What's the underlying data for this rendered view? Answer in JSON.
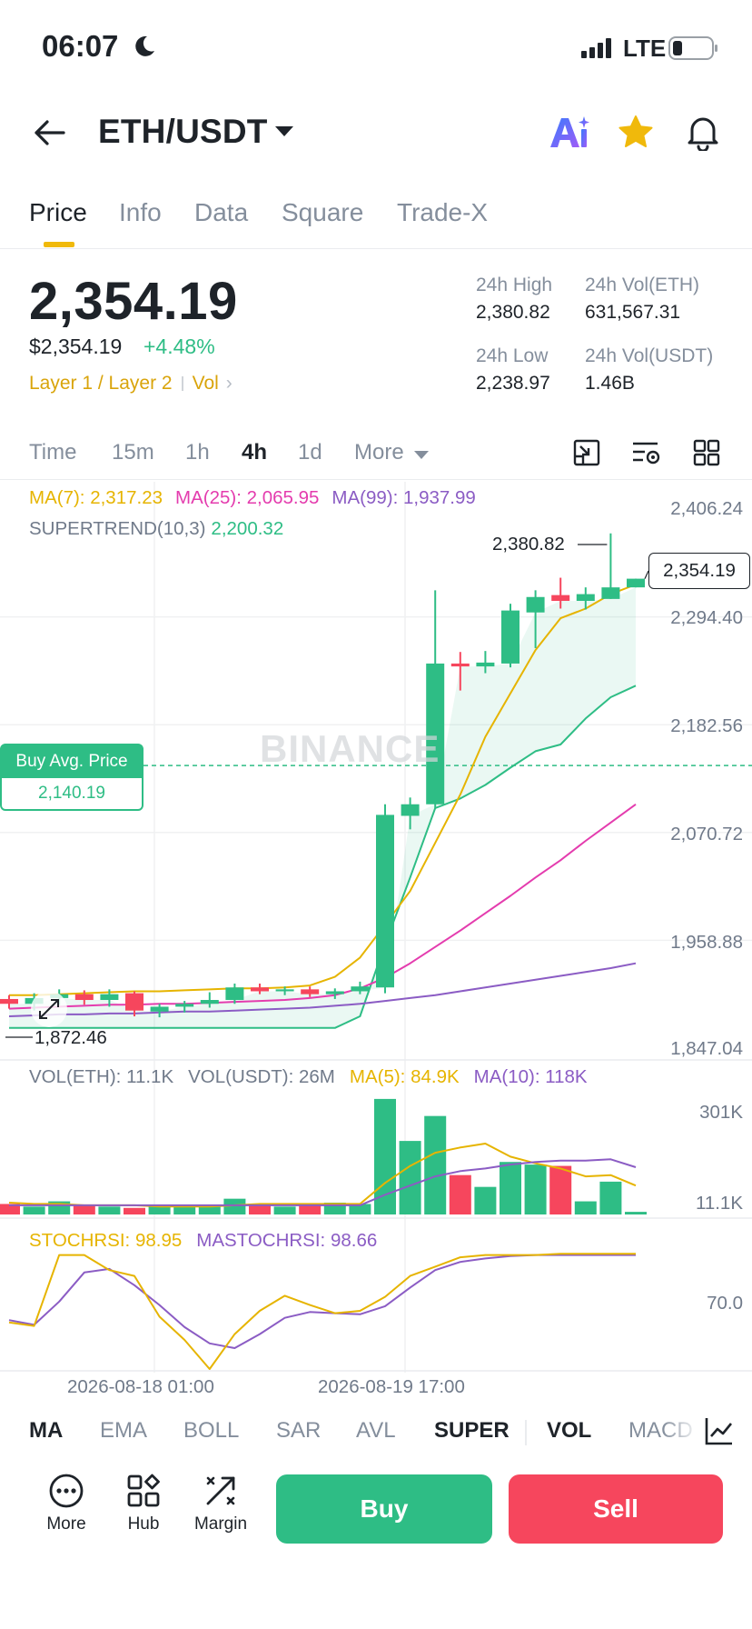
{
  "status": {
    "time": "06:07",
    "network": "LTE"
  },
  "header": {
    "pair": "ETH/USDT",
    "icons": [
      "back-arrow-icon",
      "ai-icon",
      "star-icon",
      "bell-icon"
    ]
  },
  "tabs": [
    {
      "label": "Price",
      "active": true
    },
    {
      "label": "Info"
    },
    {
      "label": "Data"
    },
    {
      "label": "Square"
    },
    {
      "label": "Trade-X"
    }
  ],
  "ticker": {
    "price": "2,354.19",
    "usd_price": "$2,354.19",
    "change": "+4.48%",
    "tag1": "Layer 1 / Layer 2",
    "tag2": "Vol",
    "stats": {
      "high_label": "24h High",
      "high": "2,380.82",
      "vol_eth_label": "24h Vol(ETH)",
      "vol_eth": "631,567.31",
      "low_label": "24h Low",
      "low": "2,238.97",
      "vol_usdt_label": "24h Vol(USDT)",
      "vol_usdt": "1.46B"
    }
  },
  "timeframes": {
    "items": [
      "Time",
      "15m",
      "1h",
      "4h",
      "1d",
      "More"
    ],
    "active": "4h"
  },
  "legend": {
    "ma7": "MA(7): 2,317.23",
    "ma25": "MA(25): 2,065.95",
    "ma99": "MA(99): 1,937.99",
    "supertrend_label": "SUPERTREND(10,3)",
    "supertrend_value": "2,200.32"
  },
  "price_axis": [
    "2,406.24",
    "2,294.40",
    "2,182.56",
    "2,070.72",
    "1,958.88",
    "1,847.04"
  ],
  "markers": {
    "current_price": "2,354.19",
    "high": "2,380.82",
    "low": "1,872.46",
    "buy_avg_label": "Buy Avg. Price",
    "buy_avg_value": "2,140.19",
    "watermark": "BINANCE"
  },
  "volume": {
    "vol_eth": "VOL(ETH): 11.1K",
    "vol_usdt": "VOL(USDT): 26M",
    "ma5": "MA(5): 84.9K",
    "ma10": "MA(10): 118K",
    "axis": [
      "301K",
      "11.1K"
    ]
  },
  "stochrsi": {
    "stoch": "STOCHRSI: 98.95",
    "mastoch": "MASTOCHRSI: 98.66",
    "axis": "70.0"
  },
  "dates": [
    "2026-08-18 01:00",
    "2026-08-19 17:00"
  ],
  "indicators": {
    "items": [
      "MA",
      "EMA",
      "BOLL",
      "SAR",
      "AVL",
      "SUPER",
      "VOL",
      "MACD"
    ],
    "active": [
      "MA",
      "SUPER",
      "VOL"
    ]
  },
  "bottom": {
    "more": "More",
    "hub": "Hub",
    "margin": "Margin",
    "buy": "Buy",
    "sell": "Sell"
  },
  "colors": {
    "up": "#2ebd85",
    "down": "#f6465d",
    "accent": "#f0b90b",
    "ma7": "#e6b400",
    "ma25": "#e43cae",
    "ma99": "#8b5cc4"
  },
  "chart_data": {
    "type": "candlestick",
    "interval": "4h",
    "y_range": [
      1847.04,
      2406.24
    ],
    "candles": [
      {
        "o": 1898,
        "h": 1902,
        "l": 1888,
        "c": 1893
      },
      {
        "o": 1893,
        "h": 1904,
        "l": 1886,
        "c": 1899
      },
      {
        "o": 1899,
        "h": 1908,
        "l": 1892,
        "c": 1903
      },
      {
        "o": 1903,
        "h": 1907,
        "l": 1892,
        "c": 1897
      },
      {
        "o": 1897,
        "h": 1908,
        "l": 1890,
        "c": 1903
      },
      {
        "o": 1904,
        "h": 1906,
        "l": 1880,
        "c": 1886
      },
      {
        "o": 1885,
        "h": 1893,
        "l": 1879,
        "c": 1890
      },
      {
        "o": 1890,
        "h": 1896,
        "l": 1884,
        "c": 1893
      },
      {
        "o": 1893,
        "h": 1905,
        "l": 1889,
        "c": 1897
      },
      {
        "o": 1897,
        "h": 1914,
        "l": 1893,
        "c": 1910
      },
      {
        "o": 1910,
        "h": 1914,
        "l": 1903,
        "c": 1906
      },
      {
        "o": 1906,
        "h": 1911,
        "l": 1902,
        "c": 1908
      },
      {
        "o": 1908,
        "h": 1911,
        "l": 1900,
        "c": 1903
      },
      {
        "o": 1903,
        "h": 1909,
        "l": 1898,
        "c": 1906
      },
      {
        "o": 1906,
        "h": 1916,
        "l": 1903,
        "c": 1911
      },
      {
        "o": 1910,
        "h": 2100,
        "l": 1904,
        "c": 2089
      },
      {
        "o": 2088,
        "h": 2107,
        "l": 2074,
        "c": 2100
      },
      {
        "o": 2100,
        "h": 2322,
        "l": 2096,
        "c": 2246
      },
      {
        "o": 2246,
        "h": 2258,
        "l": 2218,
        "c": 2243
      },
      {
        "o": 2243,
        "h": 2259,
        "l": 2236,
        "c": 2247
      },
      {
        "o": 2246,
        "h": 2308,
        "l": 2242,
        "c": 2301
      },
      {
        "o": 2299,
        "h": 2322,
        "l": 2262,
        "c": 2315
      },
      {
        "o": 2317,
        "h": 2335,
        "l": 2303,
        "c": 2311
      },
      {
        "o": 2311,
        "h": 2325,
        "l": 2302,
        "c": 2318
      },
      {
        "o": 2313,
        "h": 2381,
        "l": 2313,
        "c": 2325
      },
      {
        "o": 2325,
        "h": 2334,
        "l": 2325,
        "c": 2334
      }
    ],
    "ma7": [
      1902,
      1902,
      1903,
      1904,
      1905,
      1906,
      1906,
      1907,
      1908,
      1909,
      1909,
      1910,
      1912,
      1921,
      1941,
      1975,
      2010,
      2060,
      2110,
      2170,
      2215,
      2260,
      2293,
      2303,
      2318,
      2328
    ],
    "ma25": [
      1888,
      1889,
      1890,
      1891,
      1892,
      1892,
      1893,
      1893,
      1894,
      1895,
      1896,
      1897,
      1899,
      1902,
      1909,
      1920,
      1935,
      1952,
      1969,
      1987,
      2005,
      2024,
      2042,
      2062,
      2081,
      2100
    ],
    "ma99": [
      1880,
      1881,
      1882,
      1882,
      1883,
      1883,
      1884,
      1885,
      1885,
      1886,
      1887,
      1888,
      1889,
      1891,
      1893,
      1896,
      1899,
      1902,
      1906,
      1910,
      1914,
      1918,
      1922,
      1926,
      1930,
      1935
    ],
    "supertrend": [
      1868,
      1868,
      1868,
      1868,
      1868,
      1868,
      1868,
      1868,
      1868,
      1868,
      1868,
      1868,
      1868,
      1868,
      1880,
      1955,
      2024,
      2096,
      2106,
      2120,
      2138,
      2155,
      2162,
      2189,
      2211,
      2223
    ],
    "volume": [
      8,
      6,
      10,
      7,
      6,
      5,
      6,
      6,
      7,
      12,
      8,
      6,
      7,
      9,
      8,
      88,
      56,
      75,
      30,
      21,
      40,
      38,
      37,
      10,
      25,
      2
    ],
    "vol_ma5": [
      9,
      8,
      8,
      7,
      7,
      7,
      6,
      6,
      6,
      7,
      8,
      8,
      8,
      8,
      8,
      24,
      37,
      47,
      51,
      54,
      44,
      39,
      35,
      29,
      30,
      22
    ],
    "vol_ma10": [
      7,
      7,
      7,
      7,
      7,
      7,
      7,
      7,
      7,
      7,
      7,
      7,
      7,
      7,
      7,
      15,
      22,
      29,
      33,
      35,
      38,
      40,
      41,
      41,
      42,
      36
    ],
    "stochrsi": [
      40,
      37,
      98,
      98,
      85,
      80,
      45,
      25,
      0,
      30,
      50,
      63,
      55,
      48,
      50,
      62,
      80,
      88,
      96,
      98,
      98,
      98,
      99,
      99,
      99,
      99
    ],
    "mastochrsi": [
      42,
      38,
      58,
      83,
      86,
      72,
      55,
      36,
      22,
      18,
      30,
      44,
      49,
      48,
      47,
      54,
      70,
      85,
      92,
      95,
      97,
      98,
      98,
      98,
      98,
      98
    ]
  }
}
